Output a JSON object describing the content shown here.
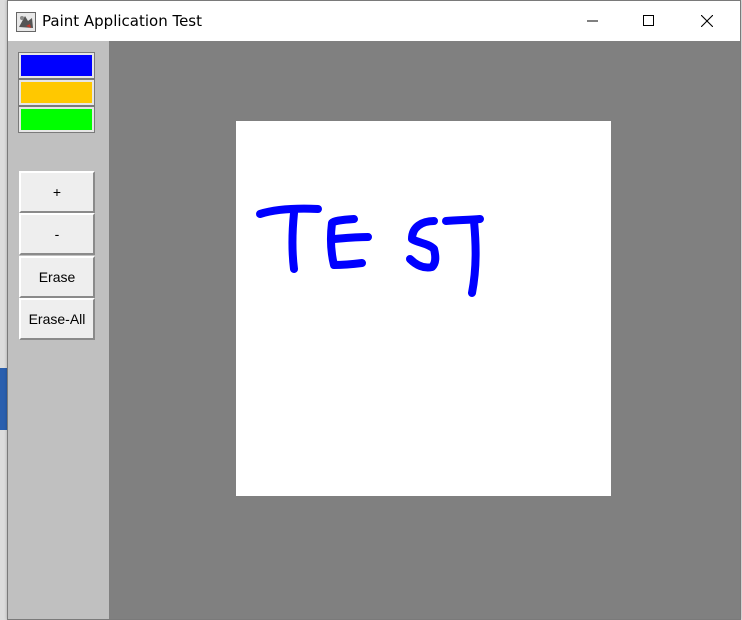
{
  "window": {
    "title": "Paint Application Test",
    "controls": [
      "minimize",
      "maximize",
      "close"
    ]
  },
  "palette": {
    "colors": [
      {
        "name": "blue",
        "hex": "#0000ff"
      },
      {
        "name": "orange",
        "hex": "#ffc800"
      },
      {
        "name": "green",
        "hex": "#00ff00"
      }
    ]
  },
  "tools": {
    "plus_label": "+",
    "minus_label": "-",
    "erase_label": "Erase",
    "erase_all_label": "Erase-All"
  },
  "canvas": {
    "drawn_text": "TEST",
    "stroke_color": "#0000ff",
    "background": "#ffffff"
  },
  "theme": {
    "sidebar_bg": "#c0c0c0",
    "workspace_bg": "#808080"
  }
}
